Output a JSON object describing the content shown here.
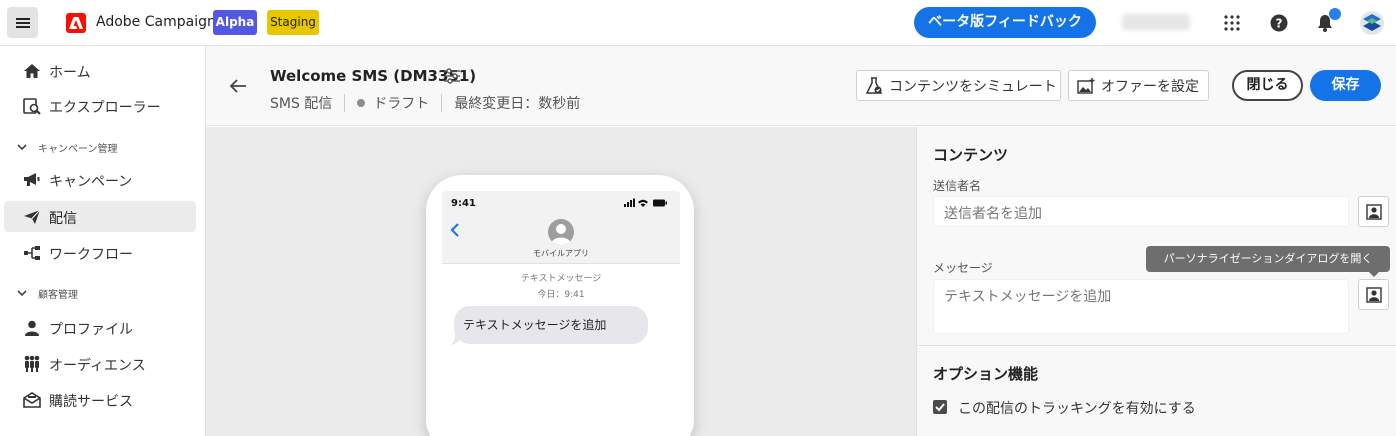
{
  "topbar": {
    "menu_icon": "hamburger-icon",
    "app_name": "Adobe Campaign",
    "badge_alpha": "Alpha",
    "badge_staging": "Staging",
    "beta_feedback": "ベータ版フィードバック",
    "icons": [
      "apps-grid-icon",
      "help-icon",
      "bell-icon",
      "avatar"
    ],
    "colors": {
      "primary": "#1473e6",
      "alpha": "#5258e4",
      "staging": "#e8c600",
      "adobe_red": "#fa0f00"
    }
  },
  "sidebar": {
    "items": [
      {
        "label": "ホーム",
        "icon": "home-icon"
      },
      {
        "label": "エクスプローラー",
        "icon": "explorer-icon"
      }
    ],
    "section_campaign": "キャンペーン管理",
    "campaign_items": [
      {
        "label": "キャンペーン",
        "icon": "megaphone-icon"
      },
      {
        "label": "配信",
        "icon": "send-icon",
        "active": true
      },
      {
        "label": "ワークフロー",
        "icon": "workflow-icon"
      }
    ],
    "section_customer": "顧客管理",
    "customer_items": [
      {
        "label": "プロファイル",
        "icon": "user-icon"
      },
      {
        "label": "オーディエンス",
        "icon": "audience-icon"
      },
      {
        "label": "購読サービス",
        "icon": "mail-subscription-icon"
      }
    ]
  },
  "header": {
    "title": "Welcome SMS (DM3351)",
    "channel": "SMS 配信",
    "status": "ドラフト",
    "last_modified": "最終変更日：数秒前",
    "simulate": "コンテンツをシミュレート",
    "offers": "オファーを設定",
    "close": "閉じる",
    "save": "保存"
  },
  "preview": {
    "time": "9:41",
    "app_name": "モバイルアプリ",
    "msg_type": "テキストメッセージ",
    "msg_time": "今日：9:41",
    "bubble": "テキストメッセージを追加"
  },
  "panel": {
    "content_title": "コンテンツ",
    "sender_label": "送信者名",
    "sender_placeholder": "送信者名を追加",
    "message_label": "メッセージ",
    "message_placeholder": "テキストメッセージを追加",
    "tooltip": "パーソナライゼーションダイアログを開く",
    "options_title": "オプション機能",
    "tracking_label": "この配信のトラッキングを有効にする",
    "tracking_checked": true
  }
}
